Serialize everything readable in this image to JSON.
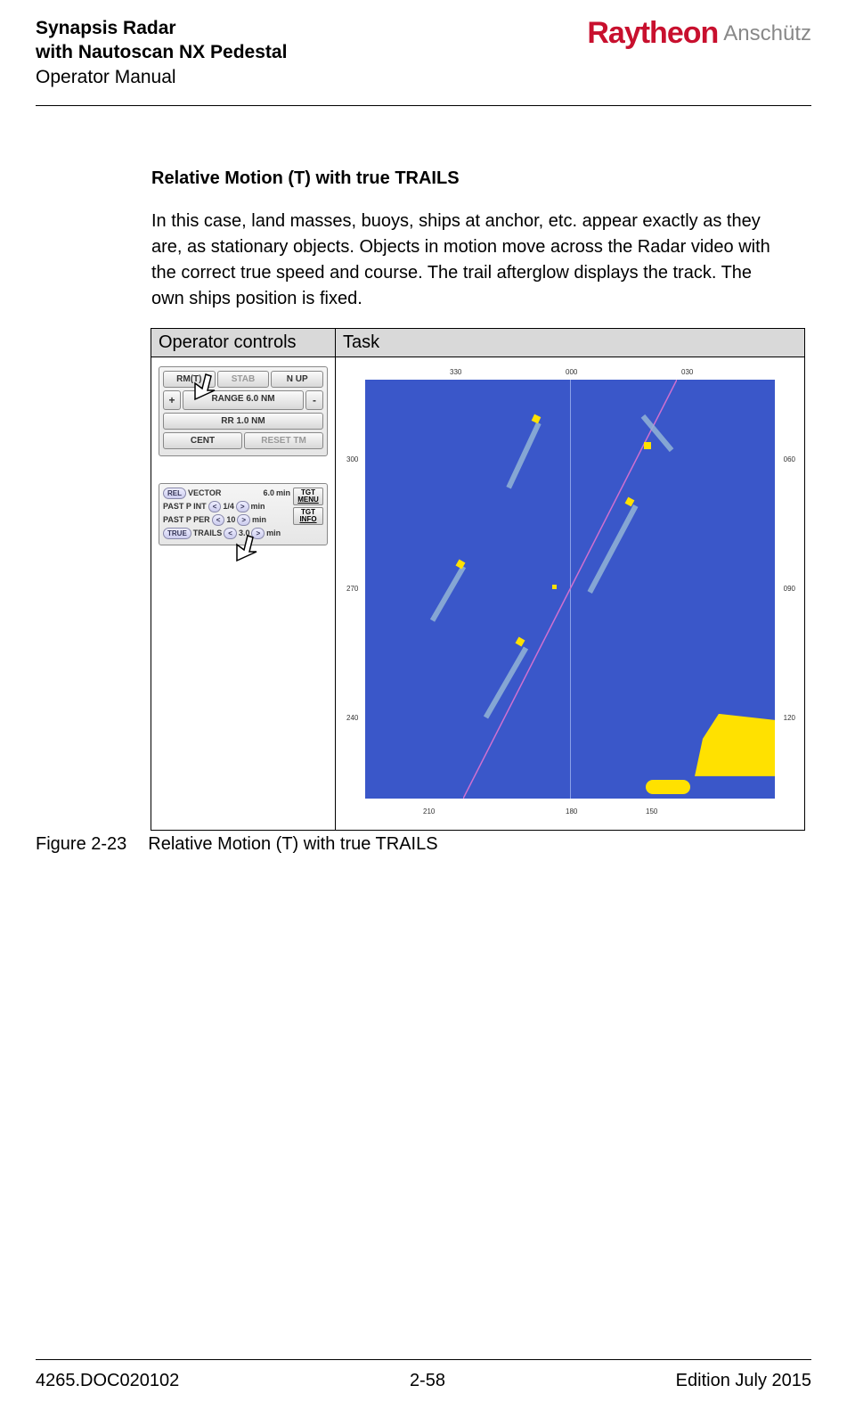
{
  "header": {
    "line1": "Synapsis Radar",
    "line2": "with Nautoscan NX Pedestal",
    "line3": "Operator Manual",
    "logo_main": "Raytheon",
    "logo_sub": "Anschütz"
  },
  "section": {
    "title": "Relative Motion (T) with true TRAILS",
    "body": "In this case, land masses, buoys, ships at anchor, etc. appear exactly as they are, as stationary objects. Objects in motion move across the Radar video with the correct true speed and course. The trail afterglow displays the track. The own ships position is fixed."
  },
  "table": {
    "h1": "Operator controls",
    "h2": "Task"
  },
  "panel1": {
    "rm": "RM(T)",
    "stab": "STAB",
    "nup": "N UP",
    "plus": "+",
    "range": "RANGE 6.0 NM",
    "minus": "-",
    "rr": "RR 1.0 NM",
    "cent": "CENT",
    "reset": "RESET TM"
  },
  "panel2": {
    "rel": "REL",
    "vector": "VECTOR",
    "vec_val": "6.0",
    "min": "min",
    "pastpint": "PAST P INT",
    "pint_val": "1/4",
    "pastpper": "PAST P PER",
    "pper_val": "10",
    "true_trails": "TRUE",
    "trails": "TRAILS",
    "trails_val": "3.0",
    "tgt_menu1": "TGT",
    "tgt_menu2": "MENU",
    "tgt_info1": "TGT",
    "tgt_info2": "INFO",
    "lt": "<",
    "gt": ">"
  },
  "radar": {
    "bearings": [
      "330",
      "000",
      "030",
      "060",
      "090",
      "120",
      "150",
      "180",
      "210",
      "240",
      "270",
      "300"
    ]
  },
  "figure": {
    "num": "Figure 2-23",
    "caption": "Relative Motion (T) with true TRAILS"
  },
  "footer": {
    "left": "4265.DOC020102",
    "center": "2-58",
    "right": "Edition July 2015"
  }
}
